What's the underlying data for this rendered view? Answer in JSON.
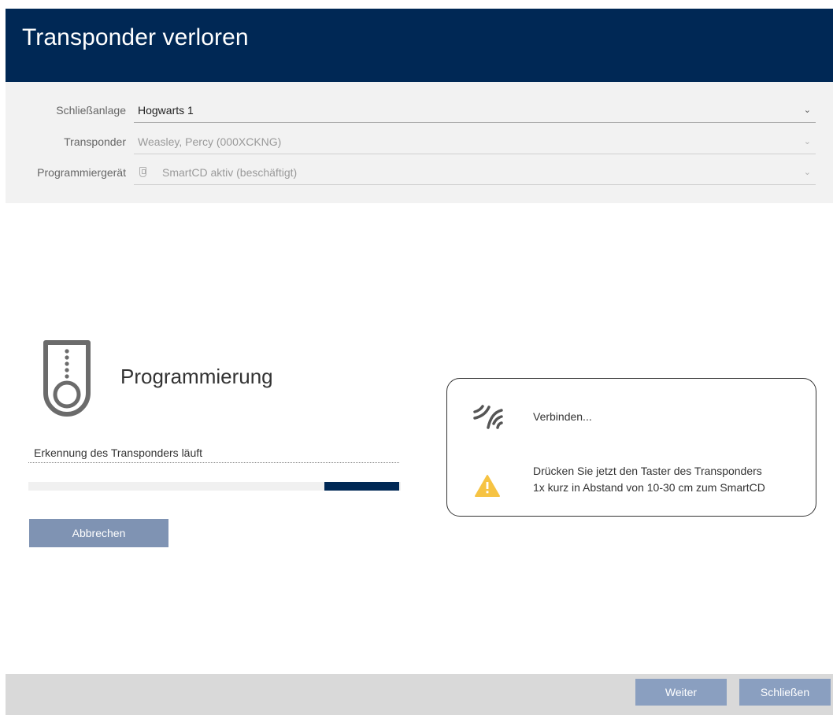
{
  "window": {
    "title": "Transponder verloren"
  },
  "form": {
    "system": {
      "label": "Schließanlage",
      "value": "Hogwarts 1"
    },
    "transponder": {
      "label": "Transponder",
      "value": "Weasley, Percy (000XCKNG)"
    },
    "programmer": {
      "label": "Programmiergerät",
      "value": "SmartCD aktiv (beschäftigt)"
    }
  },
  "programming": {
    "title": "Programmierung",
    "status": "Erkennung des Transponders läuft",
    "progress_fraction": 0.2,
    "cancel_label": "Abbrechen"
  },
  "info": {
    "connect_text": "Verbinden...",
    "instruction_line1": "Drücken Sie jetzt den Taster des Transponders",
    "instruction_line2": "1x kurz in Abstand von 10-30 cm zum SmartCD"
  },
  "footer": {
    "next_label": "Weiter",
    "close_label": "Schließen"
  },
  "colors": {
    "primary": "#002855",
    "button": "#7f93b3",
    "warning": "#f6c343"
  },
  "icons": {
    "transponder": "transponder-icon",
    "wireless": "wireless-icon",
    "warning": "warning-icon",
    "dropdown": "chevron-down-icon"
  }
}
